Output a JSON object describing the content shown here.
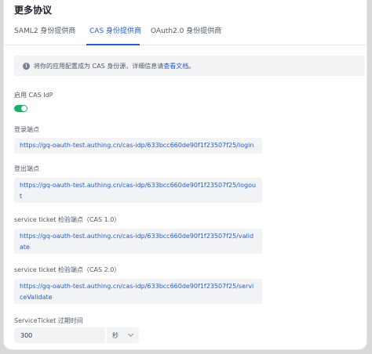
{
  "section": {
    "title": "更多协议"
  },
  "tabs": [
    {
      "label": "SAML2 身份提供商",
      "active": false
    },
    {
      "label": "CAS 身份提供商",
      "active": true
    },
    {
      "label": "OAuth2.0 身份提供商",
      "active": false
    }
  ],
  "notice": {
    "text": "将你的应用配置成为 CAS 身份源，详细信息请",
    "link": "查看文档",
    "suffix": "。"
  },
  "enable": {
    "label": "启用 CAS IdP",
    "on": true
  },
  "fields": {
    "login": {
      "label": "登录端点",
      "value": "https://gq-oauth-test.authing.cn/cas-idp/633bcc660de90f1f23507f25/login"
    },
    "logout": {
      "label": "登出端点",
      "value": "https://gq-oauth-test.authing.cn/cas-idp/633bcc660de90f1f23507f25/logout"
    },
    "validate1": {
      "label": "service ticket 检验端点（CAS 1.0）",
      "value": "https://gq-oauth-test.authing.cn/cas-idp/633bcc660de90f1f23507f25/validate"
    },
    "validate2": {
      "label": "service ticket 检验端点（CAS 2.0）",
      "value": "https://gq-oauth-test.authing.cn/cas-idp/633bcc660de90f1f23507f25/serviceValidate"
    }
  },
  "expiry": {
    "label": "ServiceTicket 过期时间",
    "value": "300",
    "unit": "秒"
  },
  "colors": {
    "accent": "#215ae5",
    "toggle_on": "#1ab26b"
  }
}
